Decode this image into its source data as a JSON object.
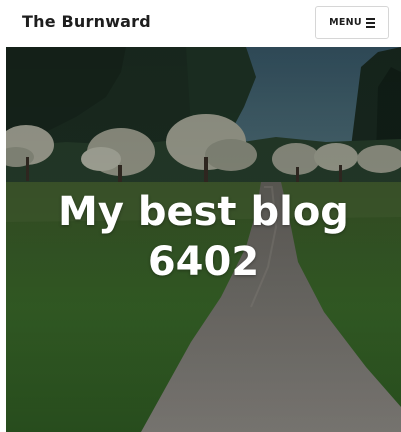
{
  "header": {
    "site_title": "The Burnward",
    "menu_label": "MENU",
    "menu_icon": "hamburger-icon"
  },
  "hero": {
    "title": "My best blog 6402",
    "image": "landscape-path-photo"
  },
  "colors": {
    "text_dark": "#1e1e1e",
    "hero_text": "#ffffff",
    "button_border": "#d6d6d6"
  }
}
